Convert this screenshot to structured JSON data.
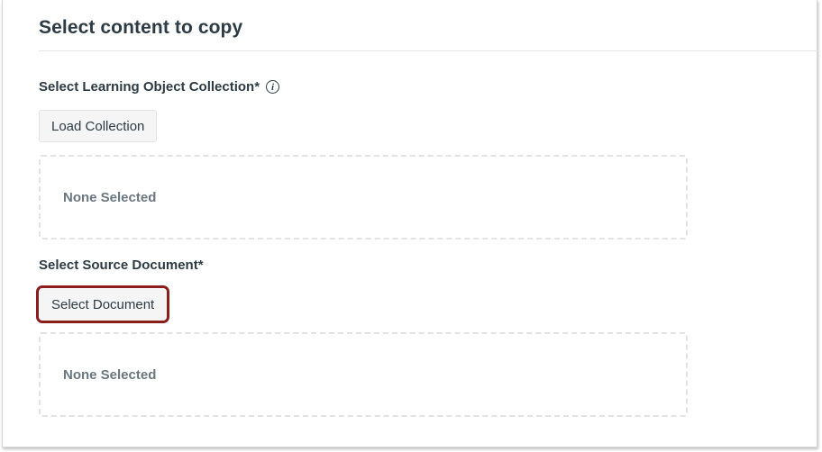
{
  "page": {
    "title": "Select content to copy"
  },
  "collection": {
    "label": "Select Learning Object Collection*",
    "info_icon": "info-icon",
    "button_label": "Load Collection",
    "empty_text": "None Selected"
  },
  "source_document": {
    "label": "Select Source Document*",
    "button_label": "Select Document",
    "empty_text": "None Selected"
  },
  "colors": {
    "text": "#2d3b45",
    "muted_text": "#6b7780",
    "highlight_outline": "#8a1e1e",
    "button_bg": "#f5f5f5",
    "dashed_border": "#e1e3e5"
  }
}
